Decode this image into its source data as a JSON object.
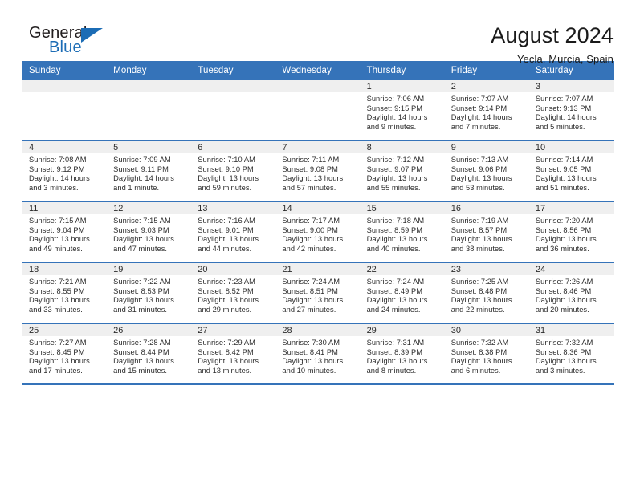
{
  "logo": {
    "word_one": "General",
    "word_two": "Blue",
    "triangle_icon": "triangle-icon",
    "brand_color": "#1b6cb5"
  },
  "header": {
    "title": "August 2024",
    "location": "Yecla, Murcia, Spain",
    "accent_color": "#3573b9",
    "daynum_bg": "#efefef"
  },
  "calendar": {
    "weekday_headers": [
      "Sunday",
      "Monday",
      "Tuesday",
      "Wednesday",
      "Thursday",
      "Friday",
      "Saturday"
    ],
    "labels": {
      "sunrise_prefix": "Sunrise:",
      "sunset_prefix": "Sunset:",
      "daylight_prefix": "Daylight:"
    },
    "weeks": [
      [
        {
          "day": "",
          "empty": true
        },
        {
          "day": "",
          "empty": true
        },
        {
          "day": "",
          "empty": true
        },
        {
          "day": "",
          "empty": true
        },
        {
          "day": "1",
          "sunrise": "Sunrise: 7:06 AM",
          "sunset": "Sunset: 9:15 PM",
          "daylight": "Daylight: 14 hours and 9 minutes."
        },
        {
          "day": "2",
          "sunrise": "Sunrise: 7:07 AM",
          "sunset": "Sunset: 9:14 PM",
          "daylight": "Daylight: 14 hours and 7 minutes."
        },
        {
          "day": "3",
          "sunrise": "Sunrise: 7:07 AM",
          "sunset": "Sunset: 9:13 PM",
          "daylight": "Daylight: 14 hours and 5 minutes."
        }
      ],
      [
        {
          "day": "4",
          "sunrise": "Sunrise: 7:08 AM",
          "sunset": "Sunset: 9:12 PM",
          "daylight": "Daylight: 14 hours and 3 minutes."
        },
        {
          "day": "5",
          "sunrise": "Sunrise: 7:09 AM",
          "sunset": "Sunset: 9:11 PM",
          "daylight": "Daylight: 14 hours and 1 minute."
        },
        {
          "day": "6",
          "sunrise": "Sunrise: 7:10 AM",
          "sunset": "Sunset: 9:10 PM",
          "daylight": "Daylight: 13 hours and 59 minutes."
        },
        {
          "day": "7",
          "sunrise": "Sunrise: 7:11 AM",
          "sunset": "Sunset: 9:08 PM",
          "daylight": "Daylight: 13 hours and 57 minutes."
        },
        {
          "day": "8",
          "sunrise": "Sunrise: 7:12 AM",
          "sunset": "Sunset: 9:07 PM",
          "daylight": "Daylight: 13 hours and 55 minutes."
        },
        {
          "day": "9",
          "sunrise": "Sunrise: 7:13 AM",
          "sunset": "Sunset: 9:06 PM",
          "daylight": "Daylight: 13 hours and 53 minutes."
        },
        {
          "day": "10",
          "sunrise": "Sunrise: 7:14 AM",
          "sunset": "Sunset: 9:05 PM",
          "daylight": "Daylight: 13 hours and 51 minutes."
        }
      ],
      [
        {
          "day": "11",
          "sunrise": "Sunrise: 7:15 AM",
          "sunset": "Sunset: 9:04 PM",
          "daylight": "Daylight: 13 hours and 49 minutes."
        },
        {
          "day": "12",
          "sunrise": "Sunrise: 7:15 AM",
          "sunset": "Sunset: 9:03 PM",
          "daylight": "Daylight: 13 hours and 47 minutes."
        },
        {
          "day": "13",
          "sunrise": "Sunrise: 7:16 AM",
          "sunset": "Sunset: 9:01 PM",
          "daylight": "Daylight: 13 hours and 44 minutes."
        },
        {
          "day": "14",
          "sunrise": "Sunrise: 7:17 AM",
          "sunset": "Sunset: 9:00 PM",
          "daylight": "Daylight: 13 hours and 42 minutes."
        },
        {
          "day": "15",
          "sunrise": "Sunrise: 7:18 AM",
          "sunset": "Sunset: 8:59 PM",
          "daylight": "Daylight: 13 hours and 40 minutes."
        },
        {
          "day": "16",
          "sunrise": "Sunrise: 7:19 AM",
          "sunset": "Sunset: 8:57 PM",
          "daylight": "Daylight: 13 hours and 38 minutes."
        },
        {
          "day": "17",
          "sunrise": "Sunrise: 7:20 AM",
          "sunset": "Sunset: 8:56 PM",
          "daylight": "Daylight: 13 hours and 36 minutes."
        }
      ],
      [
        {
          "day": "18",
          "sunrise": "Sunrise: 7:21 AM",
          "sunset": "Sunset: 8:55 PM",
          "daylight": "Daylight: 13 hours and 33 minutes."
        },
        {
          "day": "19",
          "sunrise": "Sunrise: 7:22 AM",
          "sunset": "Sunset: 8:53 PM",
          "daylight": "Daylight: 13 hours and 31 minutes."
        },
        {
          "day": "20",
          "sunrise": "Sunrise: 7:23 AM",
          "sunset": "Sunset: 8:52 PM",
          "daylight": "Daylight: 13 hours and 29 minutes."
        },
        {
          "day": "21",
          "sunrise": "Sunrise: 7:24 AM",
          "sunset": "Sunset: 8:51 PM",
          "daylight": "Daylight: 13 hours and 27 minutes."
        },
        {
          "day": "22",
          "sunrise": "Sunrise: 7:24 AM",
          "sunset": "Sunset: 8:49 PM",
          "daylight": "Daylight: 13 hours and 24 minutes."
        },
        {
          "day": "23",
          "sunrise": "Sunrise: 7:25 AM",
          "sunset": "Sunset: 8:48 PM",
          "daylight": "Daylight: 13 hours and 22 minutes."
        },
        {
          "day": "24",
          "sunrise": "Sunrise: 7:26 AM",
          "sunset": "Sunset: 8:46 PM",
          "daylight": "Daylight: 13 hours and 20 minutes."
        }
      ],
      [
        {
          "day": "25",
          "sunrise": "Sunrise: 7:27 AM",
          "sunset": "Sunset: 8:45 PM",
          "daylight": "Daylight: 13 hours and 17 minutes."
        },
        {
          "day": "26",
          "sunrise": "Sunrise: 7:28 AM",
          "sunset": "Sunset: 8:44 PM",
          "daylight": "Daylight: 13 hours and 15 minutes."
        },
        {
          "day": "27",
          "sunrise": "Sunrise: 7:29 AM",
          "sunset": "Sunset: 8:42 PM",
          "daylight": "Daylight: 13 hours and 13 minutes."
        },
        {
          "day": "28",
          "sunrise": "Sunrise: 7:30 AM",
          "sunset": "Sunset: 8:41 PM",
          "daylight": "Daylight: 13 hours and 10 minutes."
        },
        {
          "day": "29",
          "sunrise": "Sunrise: 7:31 AM",
          "sunset": "Sunset: 8:39 PM",
          "daylight": "Daylight: 13 hours and 8 minutes."
        },
        {
          "day": "30",
          "sunrise": "Sunrise: 7:32 AM",
          "sunset": "Sunset: 8:38 PM",
          "daylight": "Daylight: 13 hours and 6 minutes."
        },
        {
          "day": "31",
          "sunrise": "Sunrise: 7:32 AM",
          "sunset": "Sunset: 8:36 PM",
          "daylight": "Daylight: 13 hours and 3 minutes."
        }
      ]
    ]
  }
}
